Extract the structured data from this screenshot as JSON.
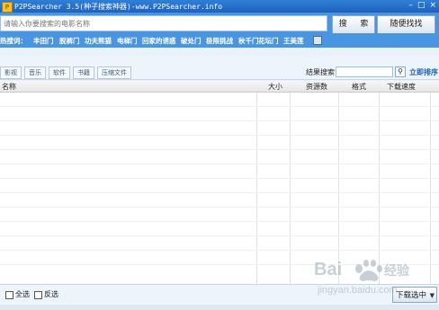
{
  "window": {
    "title": "P2PSearcher 3.5(种子搜索神器)-www.P2PSearcher.info",
    "app_icon": "P"
  },
  "search": {
    "placeholder": "请输入你要搜索的电影名称",
    "button_label": "搜 索",
    "random_label": "随便找找"
  },
  "hot": {
    "label": "热搜词：",
    "words": [
      "丰田门",
      "脱裤门",
      "功夫熊猫",
      "电梯门",
      "回家的诱惑",
      "破处门",
      "极限挑战",
      "秋千门",
      "花坛门",
      "王美莲"
    ]
  },
  "filters": [
    "影视",
    "音乐",
    "软件",
    "书籍",
    "压缩文件"
  ],
  "result_search": {
    "label": "结果搜索：",
    "value": "",
    "sort_link": "立即排序"
  },
  "table": {
    "columns": [
      "名称",
      "大小",
      "资源数",
      "格式",
      "下载速度"
    ]
  },
  "footer": {
    "select_all": "全选",
    "invert": "反选",
    "download_label": "下载选中"
  },
  "watermark": {
    "text": "Bai 经验",
    "url": "jingyan.baidu.com"
  },
  "colors": {
    "title_bar": "#1f62bd",
    "top_bar": "#4a95e1",
    "sort_link": "#1a5fb4"
  }
}
